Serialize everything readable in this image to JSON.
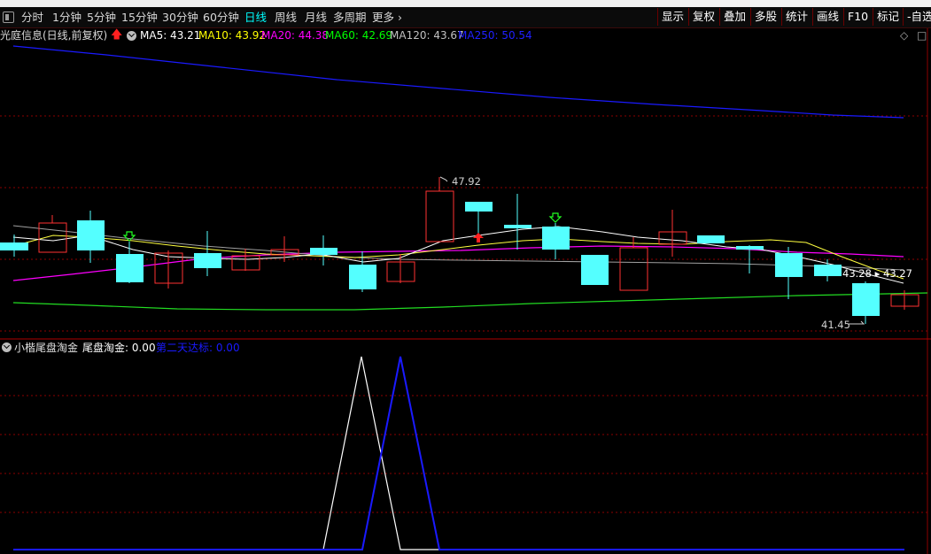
{
  "toolbar": {
    "periods": [
      "分时",
      "1分钟",
      "5分钟",
      "15分钟",
      "30分钟",
      "60分钟",
      "日线",
      "周线",
      "月线",
      "多周期",
      "更多"
    ],
    "active_period": "日线",
    "right_buttons": [
      "显示",
      "复权",
      "叠加",
      "多股",
      "统计",
      "画线",
      "F10",
      "标记",
      "-自选"
    ]
  },
  "stock": {
    "title": "光庭信息(日线,前复权)",
    "ma": [
      {
        "label": "MA5: 43.21",
        "color": "#ffffff"
      },
      {
        "label": "MA10: 43.92",
        "color": "#ffff00"
      },
      {
        "label": "MA20: 44.38",
        "color": "#ff00ff"
      },
      {
        "label": "MA60: 42.69",
        "color": "#00ff00"
      },
      {
        "label": "MA120: 43.67",
        "color": "#c0c0c0"
      },
      {
        "label": "MA250: 50.54",
        "color": "#0000ff"
      }
    ]
  },
  "annotations": {
    "high": "47.92",
    "low": "41.45",
    "last": "43.28",
    "last_right": "43.27"
  },
  "indicator": {
    "title": "小楷尾盘淘金",
    "line1": "尾盘淘金: 0.00",
    "line2": "第二天达标: 0.00"
  },
  "colors": {
    "up": "#ff3232",
    "down": "#54ffff",
    "grid": "#8b0000"
  },
  "icons": [
    "square-icon",
    "up-arrow-icon",
    "collapse-icon",
    "diamond-icon",
    "settings-icon"
  ]
}
